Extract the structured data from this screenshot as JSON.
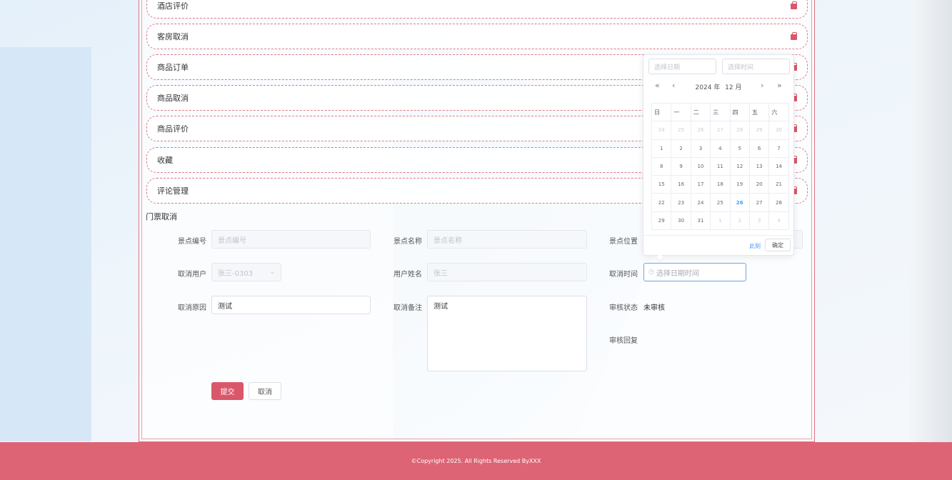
{
  "menu": {
    "items": [
      {
        "label": "酒店评价"
      },
      {
        "label": "客房取消"
      },
      {
        "label": "商品订单"
      },
      {
        "label": "商品取消"
      },
      {
        "label": "商品评价"
      },
      {
        "label": "收藏"
      },
      {
        "label": "评论管理"
      }
    ]
  },
  "form": {
    "title": "门票取消",
    "spot_code": {
      "label": "景点编号",
      "placeholder": "景点编号"
    },
    "spot_name": {
      "label": "景点名称",
      "placeholder": "景点名称"
    },
    "spot_location": {
      "label": "景点位置"
    },
    "cancel_user": {
      "label": "取消用户",
      "value": "张三-0303"
    },
    "user_name": {
      "label": "用户姓名",
      "value": "张三"
    },
    "cancel_time": {
      "label": "取消时间",
      "placeholder": "选择日期时间"
    },
    "cancel_reason": {
      "label": "取消原因",
      "value": "测试"
    },
    "cancel_note": {
      "label": "取消备注",
      "value": "测试"
    },
    "review_status": {
      "label": "审核状态",
      "value": "未审核"
    },
    "review_reply": {
      "label": "审核回复"
    },
    "submit_label": "提交",
    "cancel_label": "取消"
  },
  "picker": {
    "date_placeholder": "选择日期",
    "time_placeholder": "选择时间",
    "prev_year": "«",
    "prev_month": "‹",
    "next_month": "›",
    "next_year": "»",
    "year_label": "2024 年",
    "month_label": "12 月",
    "weekdays": [
      "日",
      "一",
      "二",
      "三",
      "四",
      "五",
      "六"
    ],
    "weeks": [
      [
        "24",
        "25",
        "26",
        "27",
        "28",
        "29",
        "30"
      ],
      [
        "1",
        "2",
        "3",
        "4",
        "5",
        "6",
        "7"
      ],
      [
        "8",
        "9",
        "10",
        "11",
        "12",
        "13",
        "14"
      ],
      [
        "15",
        "16",
        "17",
        "18",
        "19",
        "20",
        "21"
      ],
      [
        "22",
        "23",
        "24",
        "25",
        "26",
        "27",
        "28"
      ],
      [
        "29",
        "30",
        "31",
        "1",
        "2",
        "3",
        "4"
      ]
    ],
    "today": "26",
    "now_label": "此刻",
    "confirm_label": "确定"
  },
  "footer": {
    "copyright": "©Copyright 2025. All Rights Reserved ByXXX"
  },
  "colors": {
    "accent": "#dd6475",
    "link": "#409eff"
  }
}
